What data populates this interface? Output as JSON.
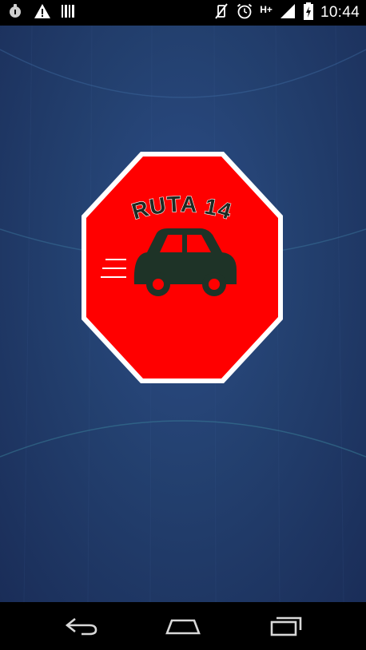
{
  "status_bar": {
    "time": "10:44",
    "network_label": "H+",
    "left_icons": [
      "android-icon",
      "warning-icon",
      "barcode-icon"
    ],
    "right_icons": [
      "no-vibrate-icon",
      "alarm-clock-icon",
      "signal-icon",
      "battery-charging-icon"
    ]
  },
  "logo": {
    "text": "RUTA 14",
    "colors": {
      "sign_fill": "#ff0000",
      "sign_border": "#ffffff",
      "car": "#1e3327",
      "text": "#1e2a22"
    }
  },
  "background": {
    "colors": [
      "#2c4d87",
      "#23406f",
      "#1a2d58"
    ]
  },
  "navigation": {
    "buttons": [
      "back",
      "home",
      "recent-apps"
    ]
  }
}
